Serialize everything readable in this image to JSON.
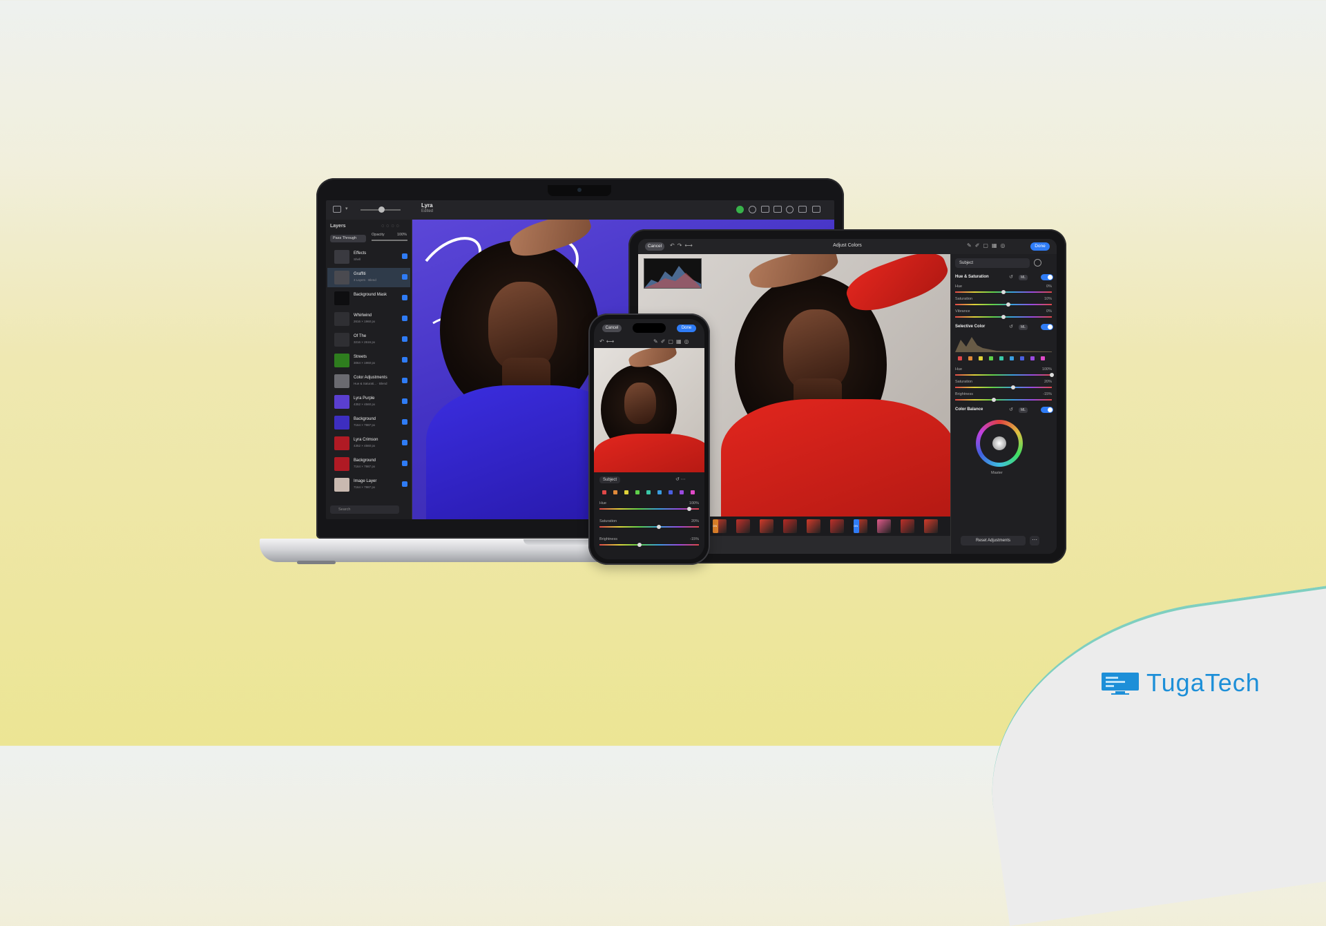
{
  "brand": {
    "name": "TugaTech"
  },
  "macbook": {
    "toolbar": {
      "title": "Lyra",
      "subtitle": "Edited"
    },
    "layers_panel": {
      "title": "Layers",
      "blend_mode": "Pass Through",
      "opacity_label": "Opacity",
      "opacity_value": "100%",
      "search_placeholder": "Search",
      "layers": [
        {
          "name": "Effects",
          "meta": "Shell"
        },
        {
          "name": "Graffiti",
          "meta": "3 Layers · Blend"
        },
        {
          "name": "Background Mask",
          "meta": ""
        },
        {
          "name": "Whirlwind",
          "meta": "2616 × 1960 px"
        },
        {
          "name": "Of The",
          "meta": "3216 × 2616 px"
        },
        {
          "name": "Streets",
          "meta": "3064 × 1960 px"
        },
        {
          "name": "Color Adjustments",
          "meta": "Hue & Saturati... · Blend"
        },
        {
          "name": "Lyra Purple",
          "meta": "4352 × 4560 px"
        },
        {
          "name": "Background",
          "meta": "7164 × 7987 px"
        },
        {
          "name": "Lyra Crimson",
          "meta": "4352 × 4560 px"
        },
        {
          "name": "Background",
          "meta": "7164 × 7987 px"
        },
        {
          "name": "Image Layer",
          "meta": "7164 × 7987 px"
        }
      ],
      "thumb_colors": [
        "#3a3a40",
        "#4a4a50",
        "#0e0e10",
        "#2f2f33",
        "#2f2f33",
        "#2e7d1e",
        "#6a6a70",
        "#5a3fd0",
        "#3d2ec0",
        "#b01a24",
        "#b01a24",
        "#c9b9b0"
      ]
    }
  },
  "ipad": {
    "cancel_label": "Cancel",
    "title": "Adjust Colors",
    "done_label": "Done",
    "panel": {
      "dropdown": "Subject",
      "hue_saturation": {
        "title": "Hue & Saturation",
        "ml_badge": "ML",
        "rows": [
          {
            "label": "Hue",
            "value": "0%"
          },
          {
            "label": "Saturation",
            "value": "10%"
          },
          {
            "label": "Vibrance",
            "value": "0%"
          }
        ]
      },
      "selective_color": {
        "title": "Selective Color",
        "ml_badge": "ML",
        "rows": [
          {
            "label": "Hue",
            "value": "100%"
          },
          {
            "label": "Saturation",
            "value": "20%"
          },
          {
            "label": "Brightness",
            "value": "-15%"
          }
        ]
      },
      "color_balance": {
        "title": "Color Balance",
        "ml_badge": "ML",
        "wheel_label": "Master"
      },
      "reset_label": "Reset Adjustments",
      "swatches": [
        "#e04848",
        "#e08a3a",
        "#e0d23a",
        "#5fd04a",
        "#3ac8a8",
        "#3a9ee0",
        "#4a5fe0",
        "#9a4ae0",
        "#e04ac8"
      ]
    },
    "filmstrip": {
      "badges": [
        "ON",
        "ON"
      ]
    }
  },
  "iphone": {
    "cancel_label": "Cancel",
    "done_label": "Done",
    "subject_label": "Subject",
    "rows": [
      {
        "label": "Hue",
        "value": "100%"
      },
      {
        "label": "Saturation",
        "value": "20%"
      },
      {
        "label": "Brightness",
        "value": "-15%"
      }
    ]
  }
}
